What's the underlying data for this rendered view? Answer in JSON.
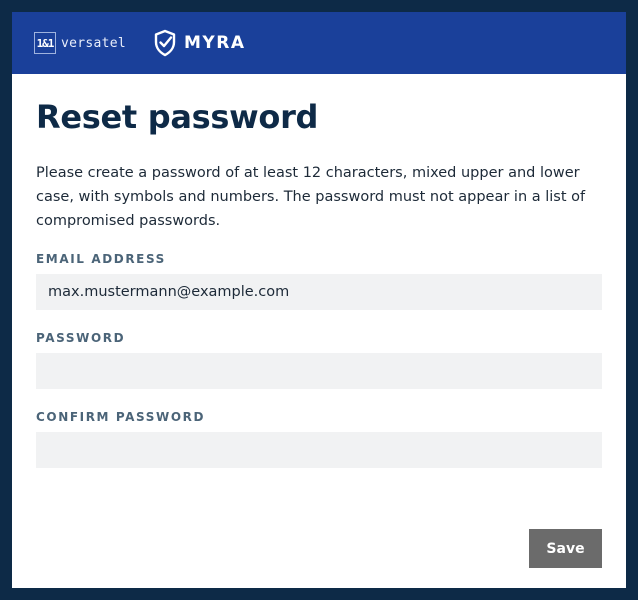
{
  "header": {
    "brand_primary_box": "1&1",
    "brand_primary_text": "versatel",
    "brand_secondary_icon": "shield-check-icon",
    "brand_secondary_text": "MYRA",
    "background_color": "#1a409a"
  },
  "page": {
    "title": "Reset password",
    "description": "Please create a password of at least 12 characters, mixed upper and lower case, with symbols and numbers. The password must not appear in a list of compromised passwords."
  },
  "form": {
    "email": {
      "label": "EMAIL ADDRESS",
      "value": "max.mustermann@example.com"
    },
    "password": {
      "label": "PASSWORD",
      "value": ""
    },
    "confirm_password": {
      "label": "CONFIRM PASSWORD",
      "value": ""
    },
    "save_label": "Save",
    "save_button_color": "#6b6b6b"
  },
  "colors": {
    "outer_background": "#0d2a47",
    "title_color": "#0e2a47",
    "field_background": "#f1f2f3"
  }
}
